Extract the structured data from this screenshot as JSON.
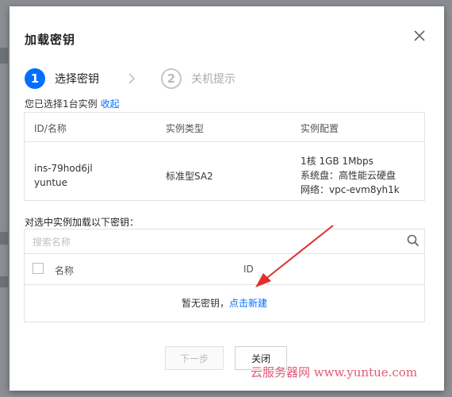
{
  "dialog": {
    "title": "加载密钥",
    "steps": [
      {
        "number": "1",
        "label": "选择密钥",
        "active": true
      },
      {
        "number": "2",
        "label": "关机提示",
        "active": false
      }
    ],
    "selected_info": "您已选择1台实例",
    "collapse_link": "收起"
  },
  "instance_table": {
    "headers": [
      "ID/名称",
      "实例类型",
      "实例配置"
    ],
    "row": {
      "id": "ins-79hod6jl",
      "name": "yuntue",
      "type": "标准型SA2",
      "config_cpu_mem_bw": "1核 1GB 1Mbps",
      "config_disk": "系统盘：高性能云硬盘",
      "config_network": "网络：vpc-evm8yh1k"
    }
  },
  "key_section": {
    "label": "对选中实例加载以下密钥：",
    "search_placeholder": "搜索名称",
    "headers": [
      "名称",
      "ID"
    ],
    "empty_text": "暂无密钥，",
    "create_link": "点击新建"
  },
  "footer": {
    "next_label": "下一步",
    "close_label": "关闭"
  },
  "watermark": "云服务器网 www.yuntue.com",
  "colors": {
    "accent": "#006eff",
    "arrow": "#e0302b",
    "watermark": "#e05a78"
  },
  "icons": [
    "close-icon",
    "chevron-right-icon",
    "search-icon"
  ]
}
